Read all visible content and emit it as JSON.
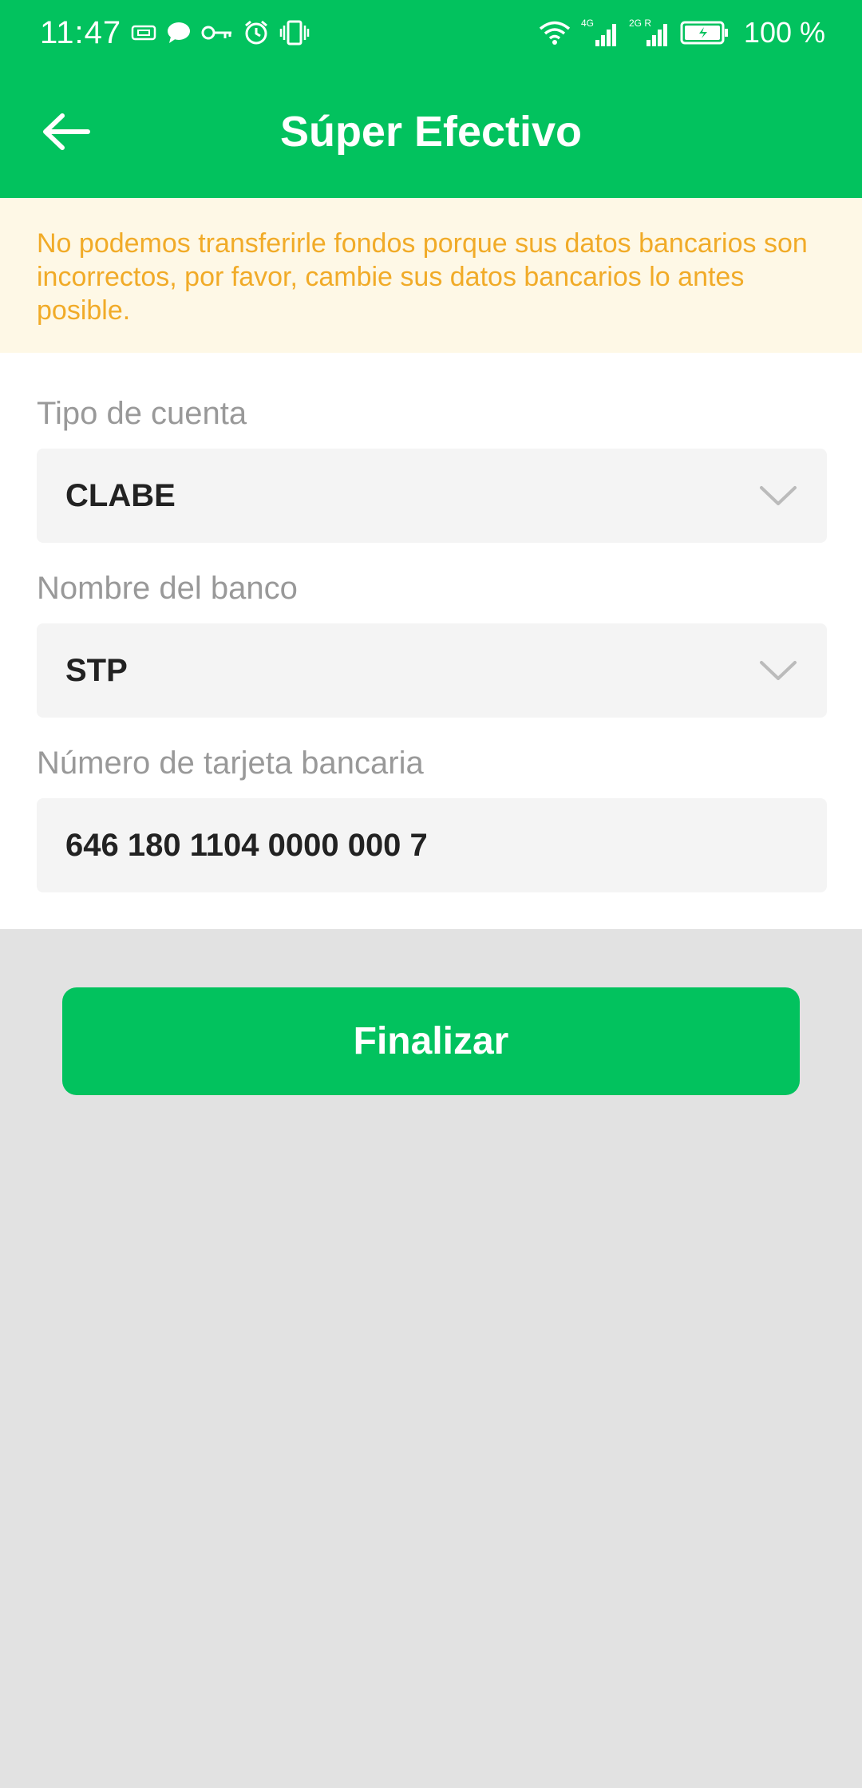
{
  "status_bar": {
    "time": "11:47",
    "battery_percent": "100 %",
    "network_1": "4G",
    "network_2": "2G R",
    "icons": [
      "sim-icon",
      "chat-icon",
      "vpn-key-icon",
      "alarm-icon",
      "vibrate-icon",
      "wifi-icon",
      "signal-icon",
      "signal-icon",
      "battery-icon"
    ]
  },
  "app_bar": {
    "title": "Súper Efectivo",
    "back_icon": "arrow-left-icon"
  },
  "warning": {
    "text": "No podemos transferirle fondos porque sus datos bancarios son incorrectos, por favor, cambie sus datos bancarios lo antes posible."
  },
  "form": {
    "account_type": {
      "label": "Tipo de cuenta",
      "value": "CLABE"
    },
    "bank_name": {
      "label": "Nombre del banco",
      "value": "STP"
    },
    "card_number": {
      "label": "Número de tarjeta bancaria",
      "value": "646 180 1104 0000 000 7"
    }
  },
  "actions": {
    "finish_label": "Finalizar"
  },
  "colors": {
    "primary": "#02c25e",
    "warning_bg": "#fef8e6",
    "warning_text": "#f1ab28",
    "page_bg": "#e2e2e2"
  }
}
